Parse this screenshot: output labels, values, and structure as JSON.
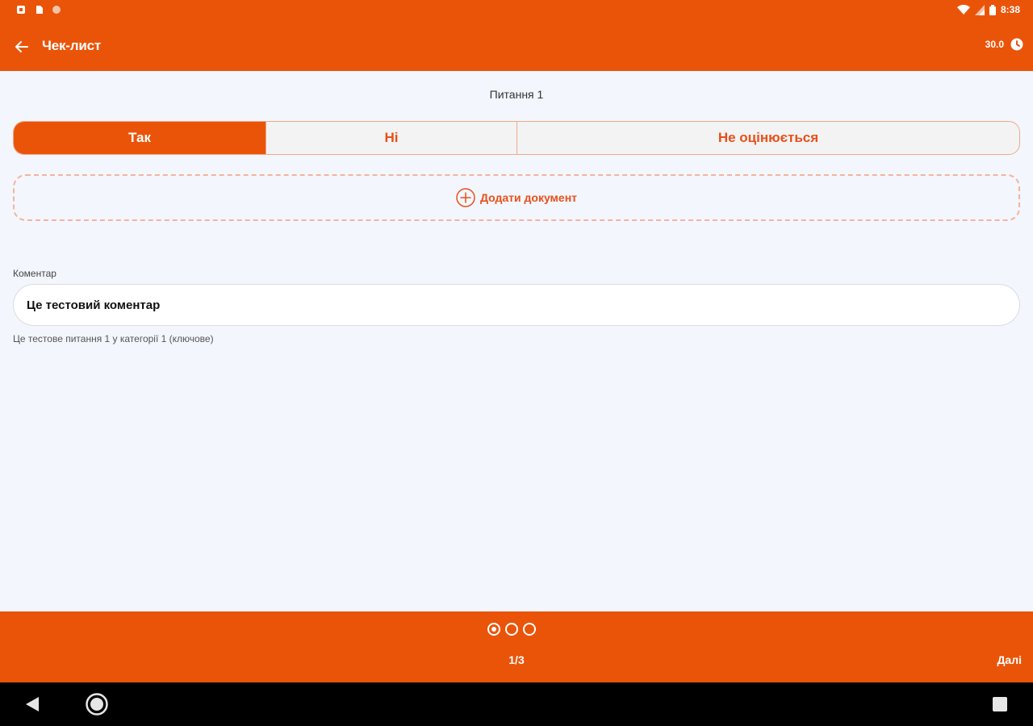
{
  "status_bar": {
    "time": "8:38",
    "icons": [
      "notification-icon",
      "sd-card-icon",
      "circle-icon",
      "wifi-icon",
      "signal-icon",
      "battery-icon"
    ]
  },
  "app_bar": {
    "title": "Чек-лист",
    "score": "30.0",
    "back_icon": "arrow-left-icon",
    "score_icon": "clock-icon"
  },
  "question": {
    "title": "Питання 1",
    "options": [
      {
        "label": "Так",
        "selected": true
      },
      {
        "label": "Ні",
        "selected": false
      },
      {
        "label": "Не оцінюється",
        "selected": false
      }
    ],
    "add_document_label": "Додати документ",
    "comment_label": "Коментар",
    "comment_value": "Це тестовий коментар",
    "helper_text": "Це тестове питання 1 у категорії 1 (ключове)"
  },
  "pager": {
    "total": 3,
    "current": 1,
    "counter_text": "1/3",
    "next_label": "Далі"
  },
  "colors": {
    "accent": "#ea5409",
    "background": "#f3f6fd",
    "accent_text": "#e8501a"
  }
}
